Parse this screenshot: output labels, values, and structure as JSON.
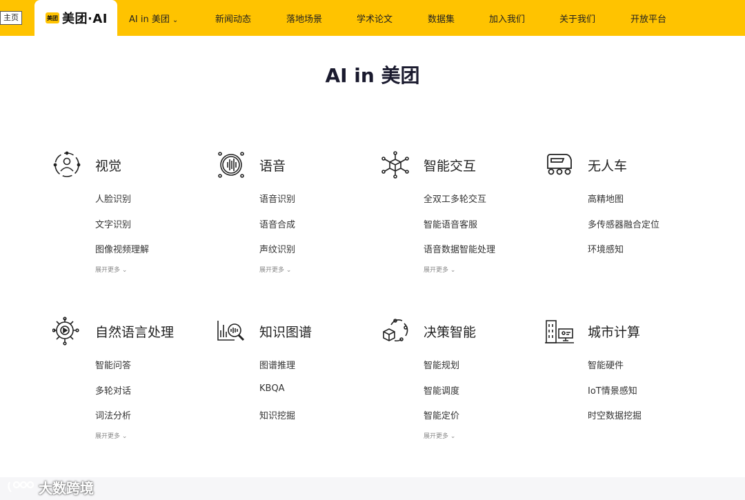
{
  "topbar": {
    "home_label": "主页",
    "logo_mark": "美团",
    "logo_text": "美团·AI",
    "nav": [
      {
        "label": "AI in 美团",
        "has_dropdown": true
      },
      {
        "label": "新闻动态"
      },
      {
        "label": "落地场景"
      },
      {
        "label": "学术论文"
      },
      {
        "label": "数据集"
      },
      {
        "label": "加入我们"
      },
      {
        "label": "关于我们"
      },
      {
        "label": "开放平台"
      }
    ],
    "bg_color": "#ffc300"
  },
  "page_title": "AI in 美团",
  "categories": [
    {
      "title": "视觉",
      "icon": "vision-icon",
      "items": [
        "人脸识别",
        "文字识别",
        "图像视频理解"
      ],
      "more": "展开更多"
    },
    {
      "title": "语音",
      "icon": "speech-icon",
      "items": [
        "语音识别",
        "语音合成",
        "声纹识别"
      ],
      "more": "展开更多"
    },
    {
      "title": "智能交互",
      "icon": "interaction-icon",
      "items": [
        "全双工多轮交互",
        "智能语音客服",
        "语音数据智能处理"
      ],
      "more": "展开更多"
    },
    {
      "title": "无人车",
      "icon": "autonomous-vehicle-icon",
      "items": [
        "高精地图",
        "多传感器融合定位",
        "环境感知"
      ],
      "more": ""
    },
    {
      "title": "自然语言处理",
      "icon": "nlp-icon",
      "items": [
        "智能问答",
        "多轮对话",
        "词法分析"
      ],
      "more": "展开更多"
    },
    {
      "title": "知识图谱",
      "icon": "knowledge-graph-icon",
      "items": [
        "图谱推理",
        "KBQA",
        "知识挖掘"
      ],
      "more": ""
    },
    {
      "title": "决策智能",
      "icon": "decision-icon",
      "items": [
        "智能规划",
        "智能调度",
        "智能定价"
      ],
      "more": "展开更多"
    },
    {
      "title": "城市计算",
      "icon": "city-computing-icon",
      "items": [
        "智能硬件",
        "IoT情景感知",
        "时空数据挖掘"
      ],
      "more": ""
    }
  ],
  "watermark": "大数跨境"
}
